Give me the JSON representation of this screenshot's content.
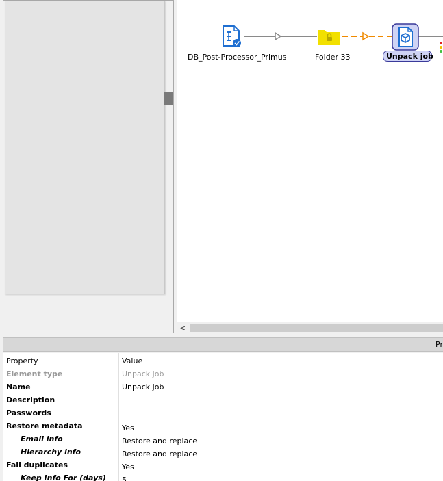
{
  "canvas": {
    "nodes": [
      {
        "label": "DB_Post-Processor_Primus",
        "icon": "db-post-processor-icon"
      },
      {
        "label": "Folder 33",
        "icon": "folder-lock-icon"
      },
      {
        "label": "Unpack job",
        "icon": "unpack-job-icon",
        "selected": true
      }
    ]
  },
  "scrollbar": {
    "left_arrow": "<"
  },
  "properties_panel": {
    "header_text": "Pr"
  },
  "properties": {
    "columns": {
      "property": "Property",
      "value": "Value"
    },
    "rows": [
      {
        "property": "Element type",
        "value": "Unpack job"
      },
      {
        "property": "Name",
        "value": "Unpack job"
      },
      {
        "property": "Description",
        "value": ""
      },
      {
        "property": "Passwords",
        "value": ""
      },
      {
        "property": "Restore metadata",
        "value": "Yes"
      },
      {
        "property": "Email info",
        "value": "Restore and replace"
      },
      {
        "property": "Hierarchy info",
        "value": "Restore and replace"
      },
      {
        "property": "Fail duplicates",
        "value": "Yes"
      },
      {
        "property": "Keep Info For (days)",
        "value": "5"
      }
    ]
  },
  "colors": {
    "connector_grey": "#8a8a8a",
    "connector_orange": "#f08a00",
    "folder_yellow": "#f2e000",
    "icon_blue": "#1f6fd1",
    "selection_fill": "#cfd3f5",
    "selection_border": "#3a3a9a"
  }
}
